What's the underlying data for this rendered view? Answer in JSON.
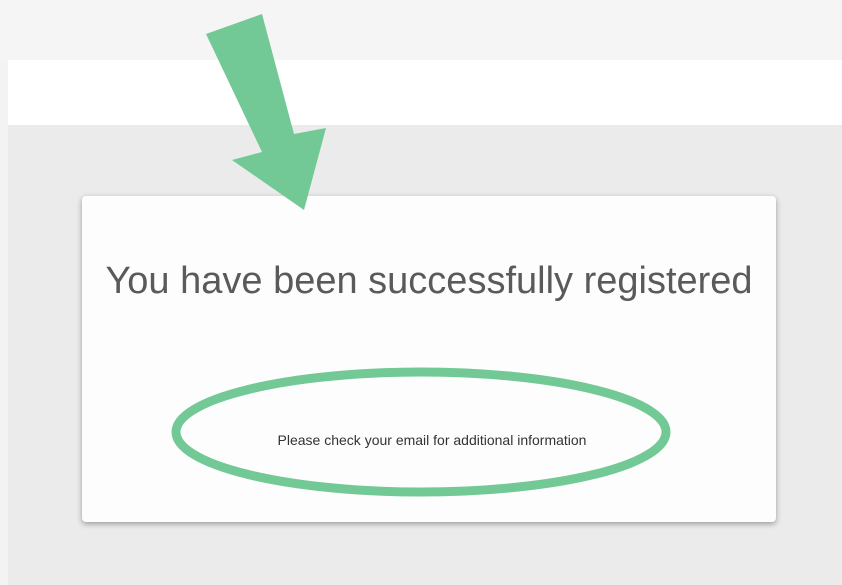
{
  "dialog": {
    "title": "You have been successfully registered",
    "message": "Please check your email for additional information"
  },
  "annotations": {
    "color": "#72c995",
    "items": [
      "arrow-icon",
      "highlight-ellipse"
    ]
  }
}
